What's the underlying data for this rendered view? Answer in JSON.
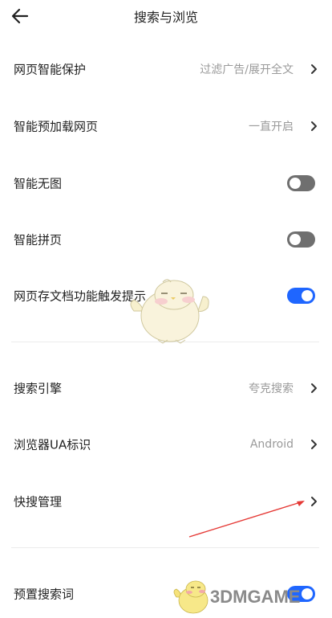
{
  "header": {
    "title": "搜索与浏览"
  },
  "rows": [
    {
      "label": "网页智能保护",
      "value": "过滤广告/展开全文"
    },
    {
      "label": "智能预加载网页",
      "value": "一直开启"
    },
    {
      "label": "智能无图",
      "toggle": "off"
    },
    {
      "label": "智能拼页",
      "toggle": "off"
    },
    {
      "label": "网页存文档功能触发提示",
      "toggle": "on"
    },
    {
      "label": "搜索引擎",
      "value": "夸克搜索"
    },
    {
      "label": "浏览器UA标识",
      "value": "Android"
    },
    {
      "label": "快搜管理"
    },
    {
      "label": "预置搜索词",
      "toggle": "on"
    }
  ],
  "watermark": {
    "brand": "3DMGAME"
  },
  "colors": {
    "accent": "#1f66ff",
    "toggle_off": "#6f6f6f",
    "annotation_arrow": "#e53935"
  }
}
